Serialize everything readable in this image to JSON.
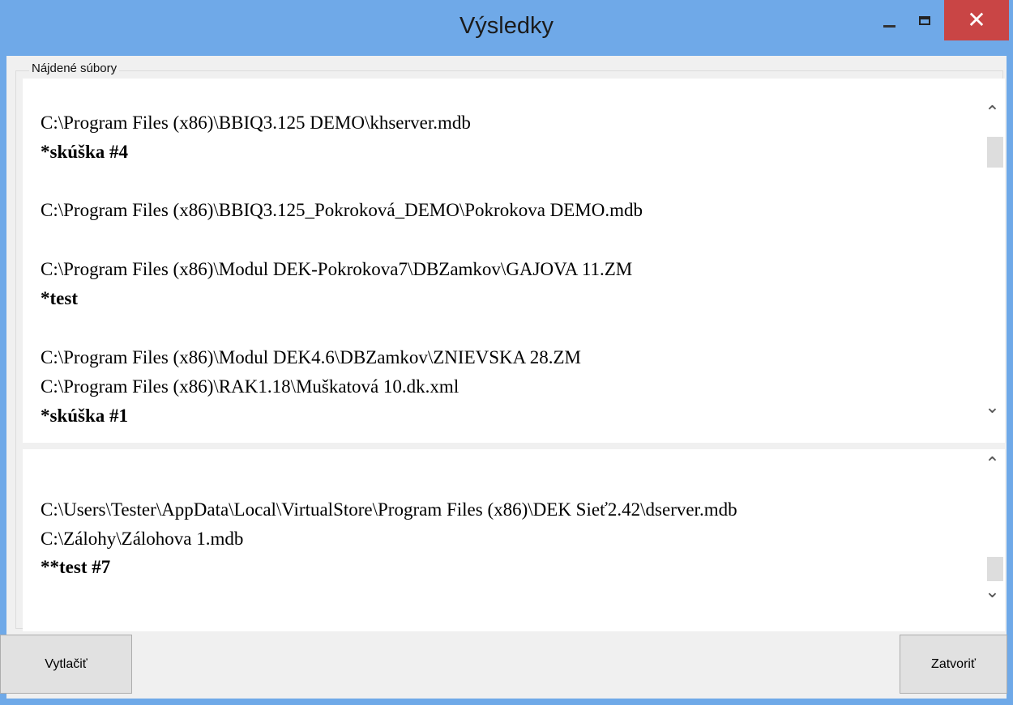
{
  "window": {
    "title": "Výsledky",
    "close_glyph": "✕"
  },
  "group": {
    "label": "Nájdené súbory"
  },
  "pane1": {
    "lines": [
      {
        "text": "C:\\Program Files (x86)\\BBIQ3.125 DEMO\\khserver.mdb",
        "bold": false
      },
      {
        "text": "*skúška #4",
        "bold": true
      },
      {
        "text": "C:\\Program Files (x86)\\BBIQ3.125_Pokroková_DEMO\\Pokrokova DEMO.mdb",
        "bold": false
      },
      {
        "text": "C:\\Program Files (x86)\\Modul DEK-Pokrokova7\\DBZamkov\\GAJOVA 11.ZM",
        "bold": false
      },
      {
        "text": "*test",
        "bold": true
      },
      {
        "text": "C:\\Program Files (x86)\\Modul DEK4.6\\DBZamkov\\ZNIEVSKA 28.ZM",
        "bold": false
      },
      {
        "text": "C:\\Program Files (x86)\\RAK1.18\\Muškatová 10.dk.xml",
        "bold": false
      },
      {
        "text": "*skúška #1",
        "bold": true
      }
    ]
  },
  "pane2": {
    "lines": [
      {
        "text": "C:\\Users\\Tester\\AppData\\Local\\VirtualStore\\Program Files (x86)\\DEK Sieť2.42\\dserver.mdb",
        "bold": false
      },
      {
        "text": "C:\\Zálohy\\Zálohova 1.mdb",
        "bold": false
      },
      {
        "text": "**test #7",
        "bold": true
      }
    ]
  },
  "scroll": {
    "up_glyph": "⌃",
    "down_glyph": "⌄"
  },
  "buttons": {
    "print_label": "Vytlačiť",
    "close_label": "Zatvoriť"
  }
}
